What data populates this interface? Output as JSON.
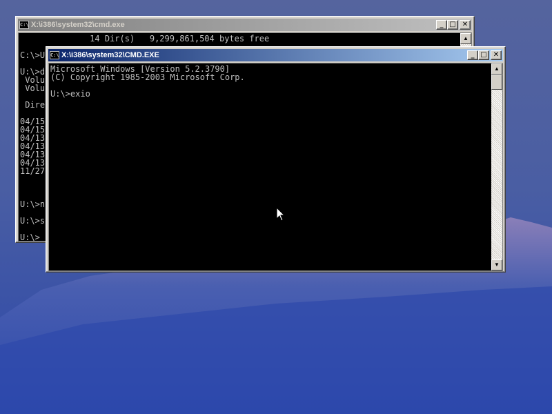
{
  "back_window": {
    "title": "X:\\i386\\system32\\cmd.exe",
    "icon_label": "C:\\",
    "console_lines": [
      "              14 Dir(s)   9,299,861,504 bytes free",
      "",
      "C:\\>U",
      "",
      "U:\\>d",
      " Volu",
      " Volu",
      "",
      " Dire",
      "",
      "04/15",
      "04/15",
      "04/13",
      "04/13",
      "04/13",
      "04/13",
      "11/27",
      "",
      "",
      "",
      "U:\\>n",
      "",
      "U:\\>s",
      "",
      "U:\\>"
    ],
    "buttons": {
      "minimize": "_",
      "maximize": "□",
      "close": "✕"
    }
  },
  "front_window": {
    "title": "X:\\i386\\system32\\CMD.EXE",
    "icon_label": "C:\\",
    "console_lines": [
      "Microsoft Windows [Version 5.2.3790]",
      "(C) Copyright 1985-2003 Microsoft Corp.",
      "",
      "U:\\>exio"
    ],
    "buttons": {
      "minimize": "_",
      "maximize": "□",
      "close": "✕"
    },
    "scroll_up": "▲",
    "scroll_down": "▼"
  },
  "colors": {
    "active_title": "#0a246a",
    "inactive_title": "#808080",
    "console_bg": "#000000",
    "console_fg": "#c0c0c0"
  },
  "icons": [
    "cmd-icon",
    "minimize-icon",
    "maximize-icon",
    "close-icon",
    "scroll-up-icon",
    "scroll-down-icon",
    "mouse-pointer-icon"
  ]
}
